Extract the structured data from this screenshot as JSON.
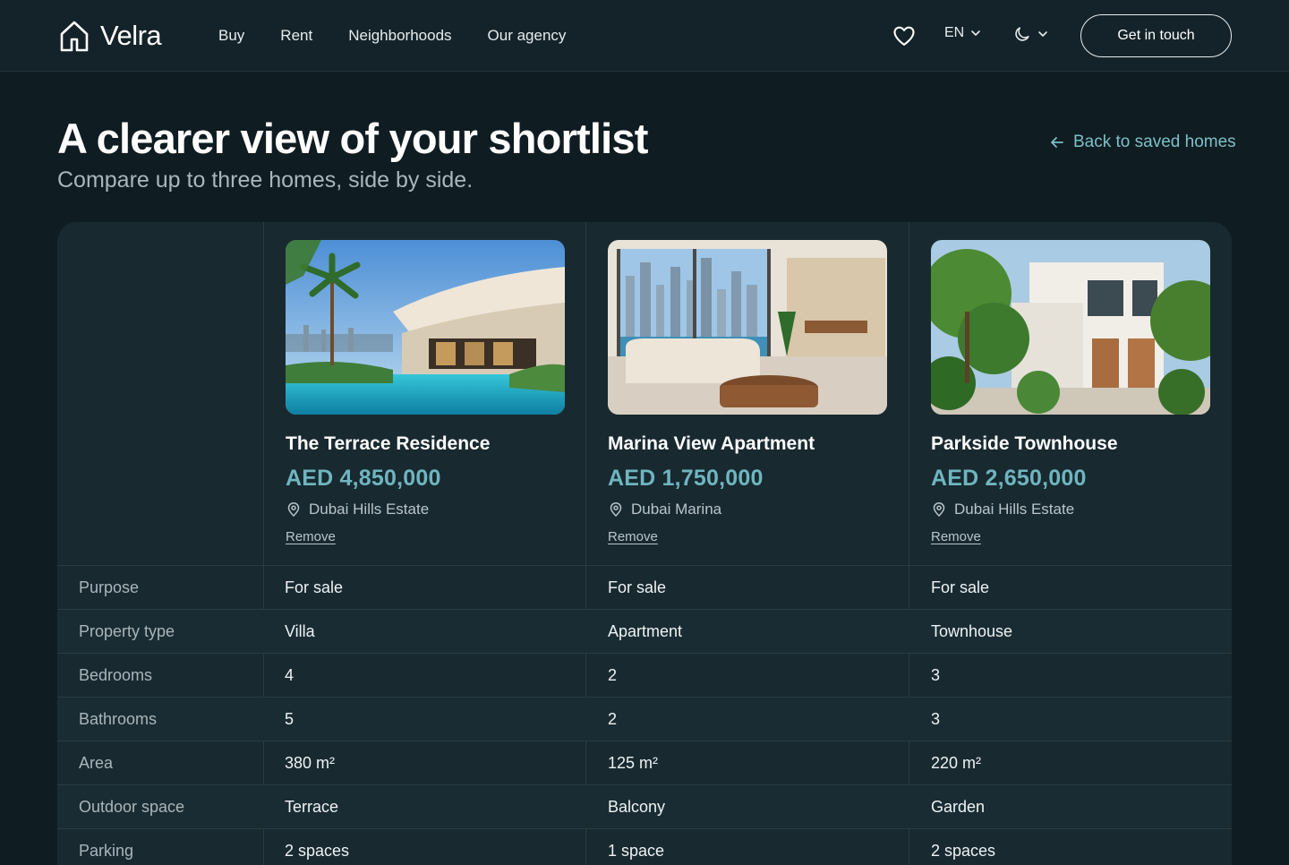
{
  "header": {
    "brand": "Velra",
    "nav": [
      {
        "label": "Buy"
      },
      {
        "label": "Rent"
      },
      {
        "label": "Neighborhoods"
      },
      {
        "label": "Our agency"
      }
    ],
    "language": "EN",
    "cta_label": "Get in touch",
    "icons": [
      "house-logo-icon",
      "heart-icon",
      "chevron-down-icon",
      "moon-icon"
    ]
  },
  "page": {
    "title": "A clearer view of your shortlist",
    "subtitle": "Compare up to three homes, side by side.",
    "back_label": "Back to saved homes"
  },
  "properties": [
    {
      "name": "The Terrace Residence",
      "price": "AED 4,850,000",
      "location": "Dubai Hills Estate",
      "remove_label": "Remove"
    },
    {
      "name": "Marina View Apartment",
      "price": "AED 1,750,000",
      "location": "Dubai Marina",
      "remove_label": "Remove"
    },
    {
      "name": "Parkside Townhouse",
      "price": "AED 2,650,000",
      "location": "Dubai Hills Estate",
      "remove_label": "Remove"
    }
  ],
  "rows": [
    {
      "label": "Purpose",
      "values": [
        "For sale",
        "For sale",
        "For sale"
      ]
    },
    {
      "label": "Property type",
      "values": [
        "Villa",
        "Apartment",
        "Townhouse"
      ]
    },
    {
      "label": "Bedrooms",
      "values": [
        "4",
        "2",
        "3"
      ]
    },
    {
      "label": "Bathrooms",
      "values": [
        "5",
        "2",
        "3"
      ]
    },
    {
      "label": "Area",
      "values": [
        "380 m²",
        "125 m²",
        "220 m²"
      ]
    },
    {
      "label": "Outdoor space",
      "values": [
        "Terrace",
        "Balcony",
        "Garden"
      ]
    },
    {
      "label": "Parking",
      "values": [
        "2 spaces",
        "1 space",
        "2 spaces"
      ]
    }
  ],
  "colors": {
    "background": "#0f1c21",
    "header": "#142329",
    "card": "#182930",
    "accent": "#6fb5bf",
    "link": "#7cc0c7"
  }
}
